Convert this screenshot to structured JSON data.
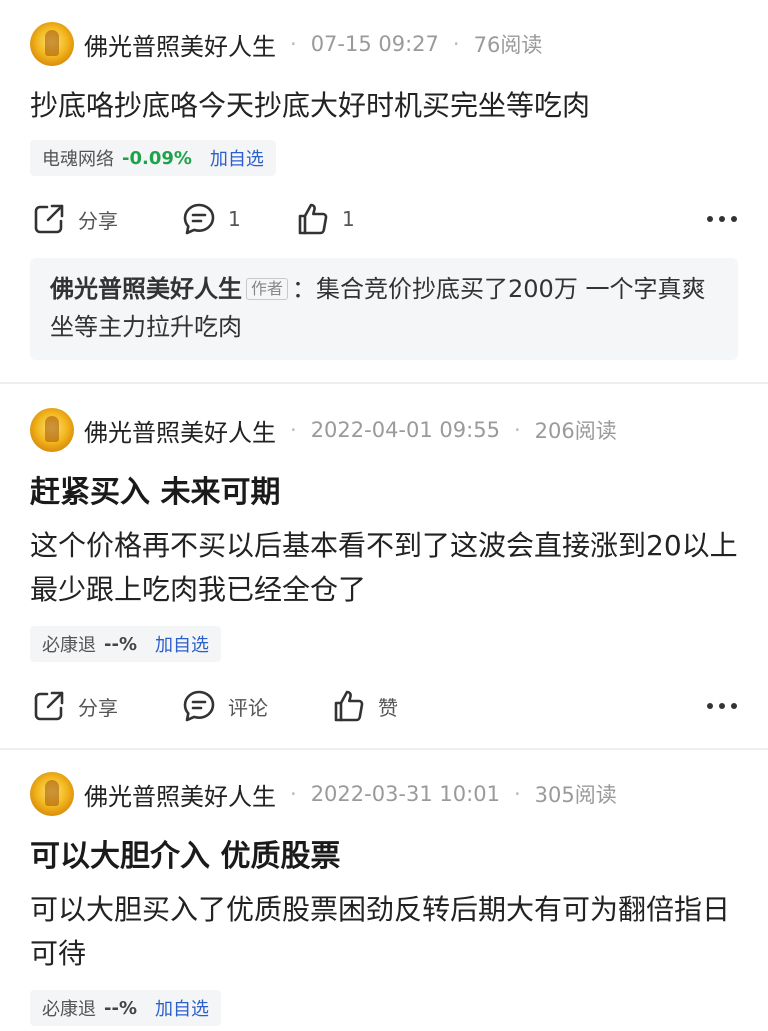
{
  "posts": [
    {
      "author": "佛光普照美好人生",
      "time": "07-15 09:27",
      "reads": "76阅读",
      "title": "",
      "body": "抄底咯抄底咯今天抄底大好时机买完坐等吃肉",
      "stock": {
        "name": "电魂网络",
        "change": "-0.09%",
        "add": "加自选"
      },
      "actions": {
        "share": "分享",
        "comment": "1",
        "like": "1"
      },
      "comment": {
        "author": "佛光普照美好人生",
        "badge": "作者",
        "text": "：集合竞价抄底买了200万 一个字真爽 坐等主力拉升吃肉"
      }
    },
    {
      "author": "佛光普照美好人生",
      "time": "2022-04-01 09:55",
      "reads": "206阅读",
      "title": "赶紧买入 未来可期",
      "body": "这个价格再不买以后基本看不到了这波会直接涨到20以上最少跟上吃肉我已经全仓了",
      "stock": {
        "name": "必康退",
        "change": "--%",
        "add": "加自选"
      },
      "actions": {
        "share": "分享",
        "comment": "评论",
        "like": "赞"
      }
    },
    {
      "author": "佛光普照美好人生",
      "time": "2022-03-31 10:01",
      "reads": "305阅读",
      "title": "可以大胆介入 优质股票",
      "body": "可以大胆买入了优质股票困劲反转后期大有可为翻倍指日可待",
      "stock": {
        "name": "必康退",
        "change": "--%",
        "add": "加自选"
      }
    }
  ],
  "colors": {
    "positive_change": "#1fa34a",
    "link": "#2b5fcc"
  }
}
